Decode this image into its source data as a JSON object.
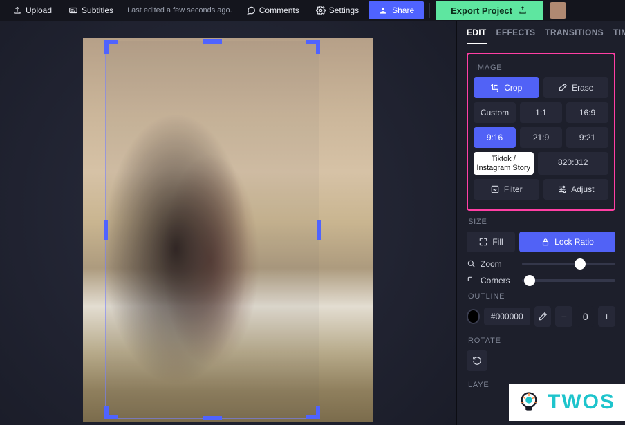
{
  "topbar": {
    "upload": "Upload",
    "subtitles": "Subtitles",
    "last_edited": "Last edited a few seconds ago.",
    "comments": "Comments",
    "settings": "Settings",
    "share": "Share",
    "export": "Export Project"
  },
  "panel": {
    "tabs": [
      "EDIT",
      "EFFECTS",
      "TRANSITIONS",
      "TIMING"
    ],
    "active_tab": 0,
    "image": {
      "label": "IMAGE",
      "crop": "Crop",
      "erase": "Erase",
      "ratios_row1": [
        "Custom",
        "1:1",
        "16:9"
      ],
      "ratios_row2": [
        "9:16",
        "21:9",
        "9:21"
      ],
      "ratio_tooltip": "Tiktok / Instagram Story",
      "dimensions": "820:312",
      "filter": "Filter",
      "adjust": "Adjust"
    },
    "size": {
      "label": "SIZE",
      "fill": "Fill",
      "lock_ratio": "Lock Ratio",
      "zoom": "Zoom",
      "corners": "Corners",
      "zoom_pct": 62,
      "corners_pct": 8
    },
    "outline": {
      "label": "OUTLINE",
      "hex": "#000000",
      "width": "0"
    },
    "rotate": {
      "label": "ROTATE"
    },
    "layer": {
      "label": "LAYE"
    }
  },
  "watermark": {
    "text": "TWOS"
  }
}
